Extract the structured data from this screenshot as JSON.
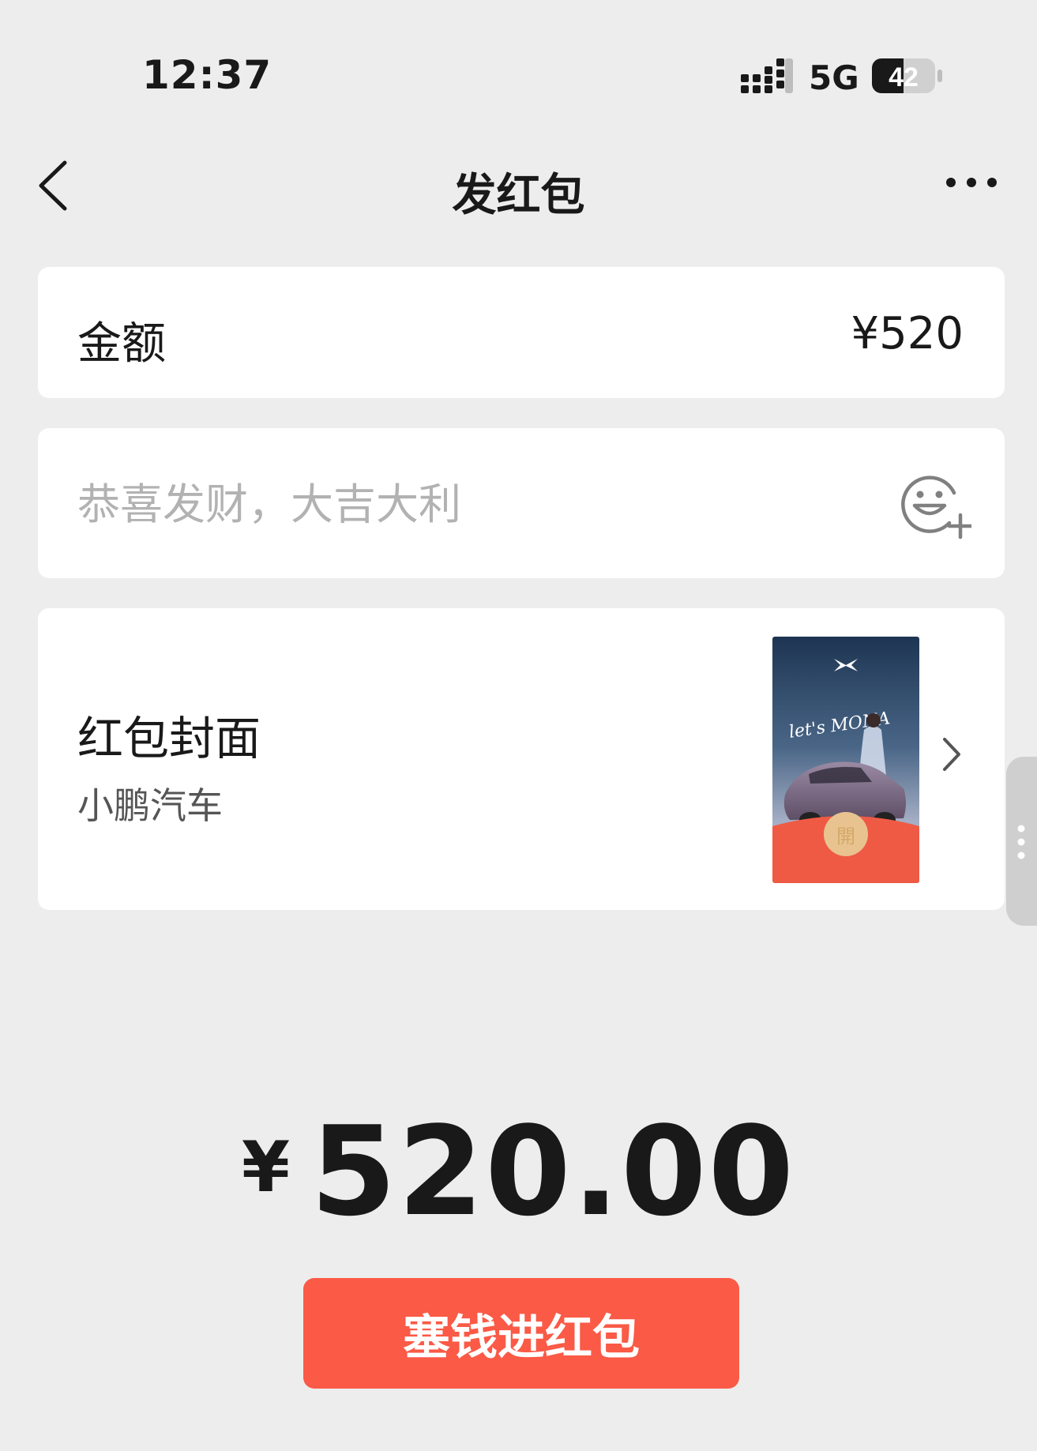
{
  "status_bar": {
    "time": "12:37",
    "network": "5G",
    "battery": "42"
  },
  "nav": {
    "title": "发红包",
    "back_icon": "chevron-left-icon",
    "more_icon": "more-dots-icon"
  },
  "amount": {
    "label": "金额",
    "value": "¥520"
  },
  "greeting": {
    "placeholder": "恭喜发财，大吉大利",
    "emoji_icon": "emoji-add-icon"
  },
  "cover": {
    "title": "红包封面",
    "brand": "小鹏汽车",
    "thumbnail_text": "let's MONA",
    "open_label": "開"
  },
  "total": {
    "currency": "¥",
    "value": "520.00"
  },
  "submit_button": {
    "label": "塞钱进红包",
    "color": "#fa5a46"
  },
  "colors": {
    "background": "#ededed",
    "card": "#ffffff",
    "accent": "#fa5a46",
    "placeholder": "#b2b2b2"
  }
}
